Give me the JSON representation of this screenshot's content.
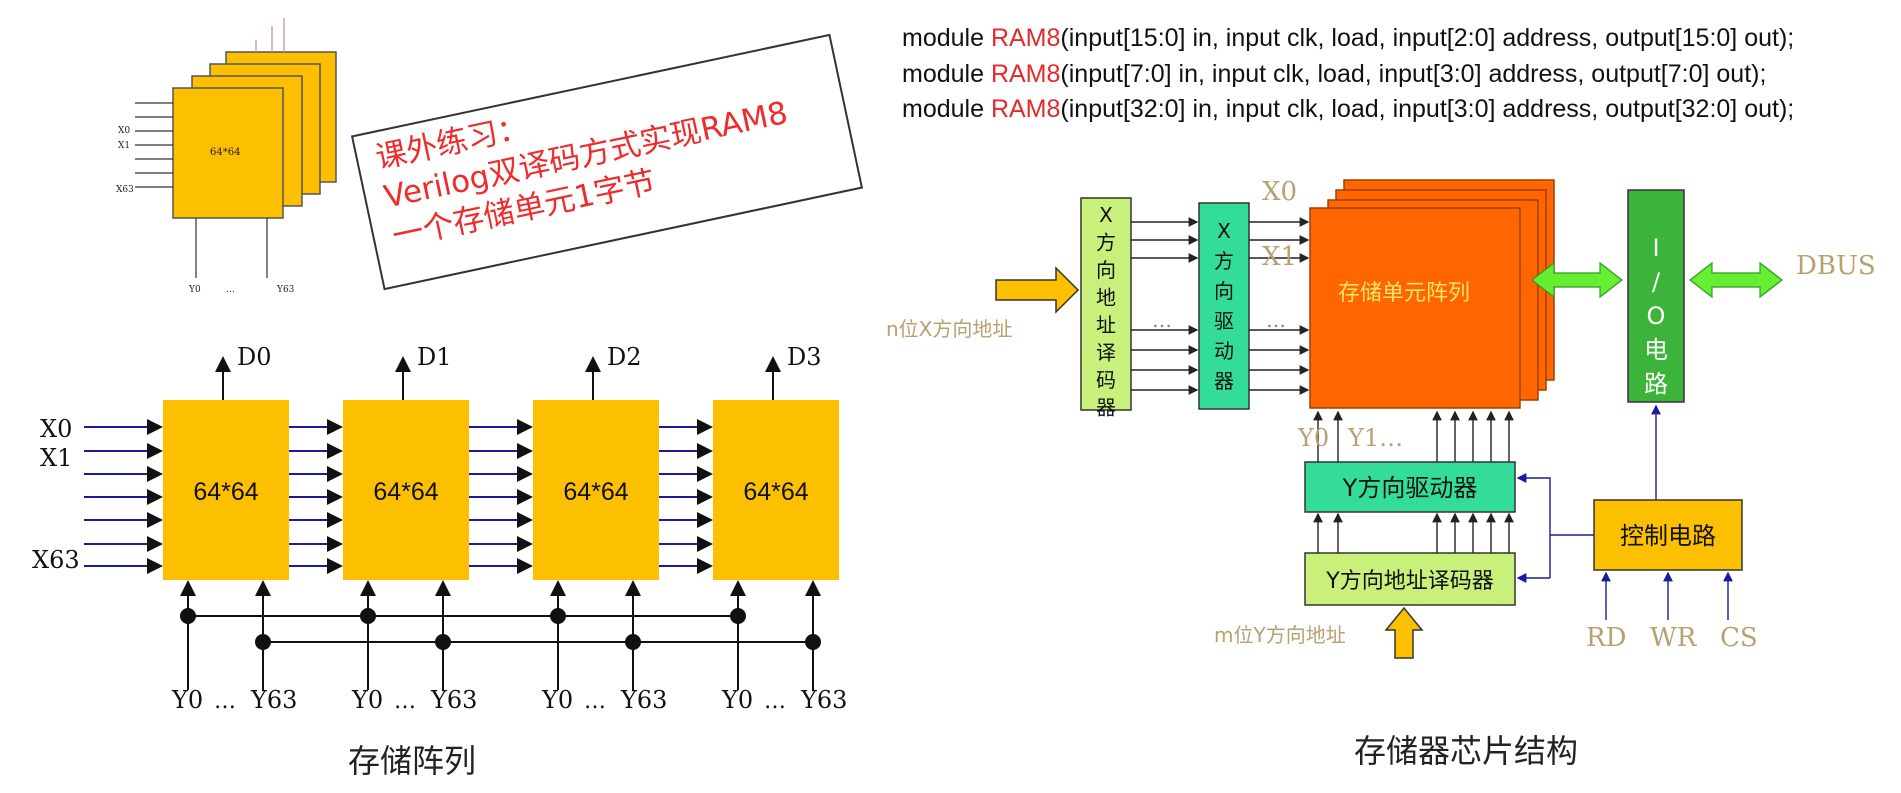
{
  "small_stack": {
    "chip_label": "64*64",
    "row_labels": [
      "X0",
      "X1",
      "X63"
    ],
    "col_labels": [
      "Y0",
      "…",
      "Y63"
    ]
  },
  "exercise": {
    "line1": "课外练习：",
    "line2": "Verilog双译码方式实现RAM8",
    "line3": "一个存储单元1字节"
  },
  "modules": [
    {
      "kw": "module ",
      "name": "RAM8",
      "rest": "(input[15:0] in, input clk, load, input[2:0] address, output[15:0] out);"
    },
    {
      "kw": "module ",
      "name": "RAM8",
      "rest": "(input[7:0] in, input clk, load, input[3:0] address, output[7:0] out);"
    },
    {
      "kw": "module ",
      "name": "RAM8",
      "rest": "(input[32:0] in, input clk, load, input[3:0] address, output[32:0] out);"
    }
  ],
  "memory_array": {
    "chips": [
      {
        "label": "64*64",
        "output": "D0"
      },
      {
        "label": "64*64",
        "output": "D1"
      },
      {
        "label": "64*64",
        "output": "D2"
      },
      {
        "label": "64*64",
        "output": "D3"
      }
    ],
    "row_labels": [
      "X0",
      "X1",
      "X63"
    ],
    "col_labels": [
      "Y0",
      "…",
      "Y63"
    ],
    "caption": "存储阵列"
  },
  "chip_structure": {
    "x_decoder": "X方向地址译码器",
    "x_driver": "X方向驱动器",
    "cell_array": "存储单元阵列",
    "io_circuit": "I/O电路",
    "dbus": "DBUS",
    "n_address": "n位X方向地址",
    "x_labels": [
      "X0",
      "X1"
    ],
    "y_labels": [
      "Y0",
      "Y1…"
    ],
    "y_driver": "Y方向驱动器",
    "y_decoder": "Y方向地址译码器",
    "m_address": "m位Y方向地址",
    "control": "控制电路",
    "signals": [
      "RD",
      "WR",
      "CS"
    ],
    "caption": "存储器芯片结构"
  },
  "colors": {
    "chip_orange": "#fcc000",
    "cell_array_orange": "#ff6600",
    "io_green": "#3cb43c",
    "x_decoder_green": "#c8f07a",
    "driver_green": "#33dd99",
    "line_blue": "#1a1aa0",
    "beige_text": "#b8a070",
    "bus_arrow_green": "#66ee33"
  }
}
